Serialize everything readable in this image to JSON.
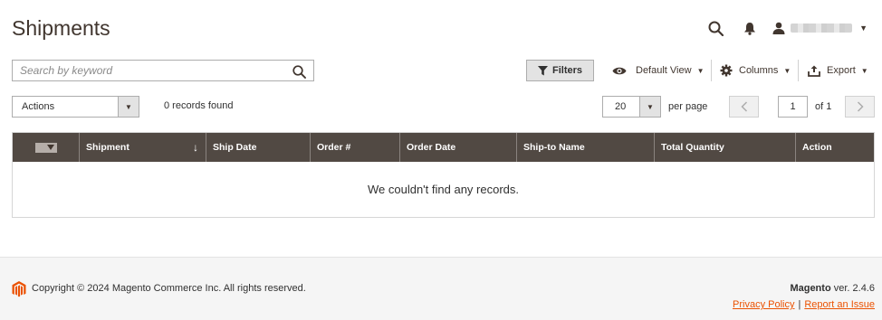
{
  "page": {
    "title": "Shipments"
  },
  "header": {
    "search_icon": "search-icon",
    "notifications_icon": "bell-icon",
    "user_icon": "user-icon"
  },
  "toolbar": {
    "search_placeholder": "Search by keyword",
    "filters_label": "Filters",
    "view_label": "Default View",
    "columns_label": "Columns",
    "export_label": "Export"
  },
  "actions": {
    "label": "Actions",
    "records_found": "0 records found"
  },
  "pagination": {
    "per_page_value": "20",
    "per_page_label": "per page",
    "current_page": "1",
    "of_label": "of 1"
  },
  "grid": {
    "columns": [
      "Shipment",
      "Ship Date",
      "Order #",
      "Order Date",
      "Ship-to Name",
      "Total Quantity",
      "Action"
    ],
    "sort_indicator": "↓",
    "empty_message": "We couldn't find any records."
  },
  "footer": {
    "copyright": "Copyright © 2024 Magento Commerce Inc. All rights reserved.",
    "brand": "Magento",
    "version": "ver. 2.4.6",
    "privacy_link": "Privacy Policy",
    "separator": "|",
    "report_link": "Report an Issue"
  },
  "colors": {
    "grid_header": "#514943",
    "link": "#eb5202",
    "title": "#41362f"
  }
}
